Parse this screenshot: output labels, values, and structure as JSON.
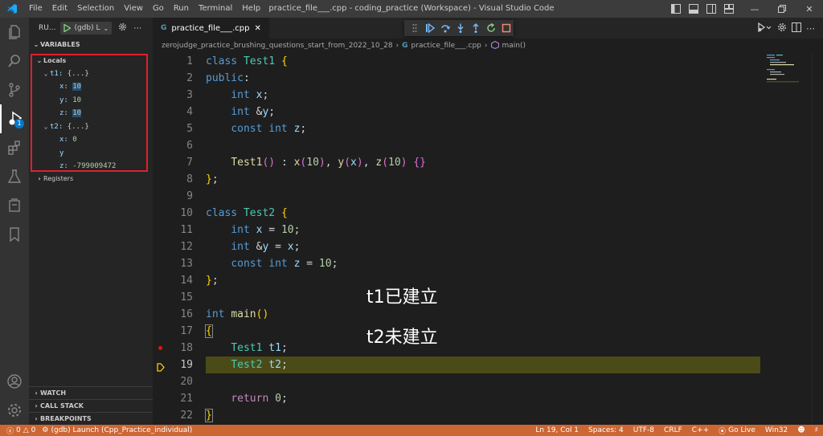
{
  "titlebar": {
    "menu": [
      "File",
      "Edit",
      "Selection",
      "View",
      "Go",
      "Run",
      "Terminal",
      "Help"
    ],
    "window_title": "practice_file___.cpp - coding_practice (Workspace) - Visual Studio Code"
  },
  "sidebar": {
    "run_label": "RU...",
    "config_label": "(gdb) L",
    "variables_header": "VARIABLES",
    "locals_label": "Locals",
    "vars": [
      {
        "name": "t1:",
        "value": "{...}"
      },
      {
        "name": "x:",
        "value": "10"
      },
      {
        "name": "y:",
        "value": "10"
      },
      {
        "name": "z:",
        "value": "10"
      },
      {
        "name": "t2:",
        "value": "{...}"
      },
      {
        "name": "x:",
        "value": "0"
      },
      {
        "name": "y",
        "value": ""
      },
      {
        "name": "z:",
        "value": "-799009472"
      }
    ],
    "registers_label": "Registers",
    "watch_label": "WATCH",
    "callstack_label": "CALL STACK",
    "breakpoints_label": "BREAKPOINTS"
  },
  "activity_badge": "1",
  "editor": {
    "tab_label": "practice_file___.cpp",
    "breadcrumb": {
      "folder": "zerojudge_practice_brushing_questions_start_from_2022_10_28",
      "file": "practice_file___.cpp",
      "symbol": "main()"
    },
    "line_numbers": [
      "1",
      "2",
      "3",
      "4",
      "5",
      "6",
      "7",
      "8",
      "9",
      "10",
      "11",
      "12",
      "13",
      "14",
      "15",
      "16",
      "17",
      "18",
      "19",
      "20",
      "21",
      "22"
    ],
    "current_line": "19",
    "breakpoint_line": "18"
  },
  "annotations": {
    "t1_created": "t1已建立",
    "t2_not_created": "t2未建立"
  },
  "statusbar": {
    "errors": "0",
    "warnings": "0",
    "launch": "(gdb) Launch (Cpp_Practice_individual)",
    "position": "Ln 19, Col 1",
    "spaces": "Spaces: 4",
    "encoding": "UTF-8",
    "eol": "CRLF",
    "language": "C++",
    "golive": "Go Live",
    "platform": "Win32"
  },
  "colors": {
    "statusbar": "#cc6633",
    "highlight_line": "#4b4b18",
    "locals_border": "#e0202a"
  }
}
